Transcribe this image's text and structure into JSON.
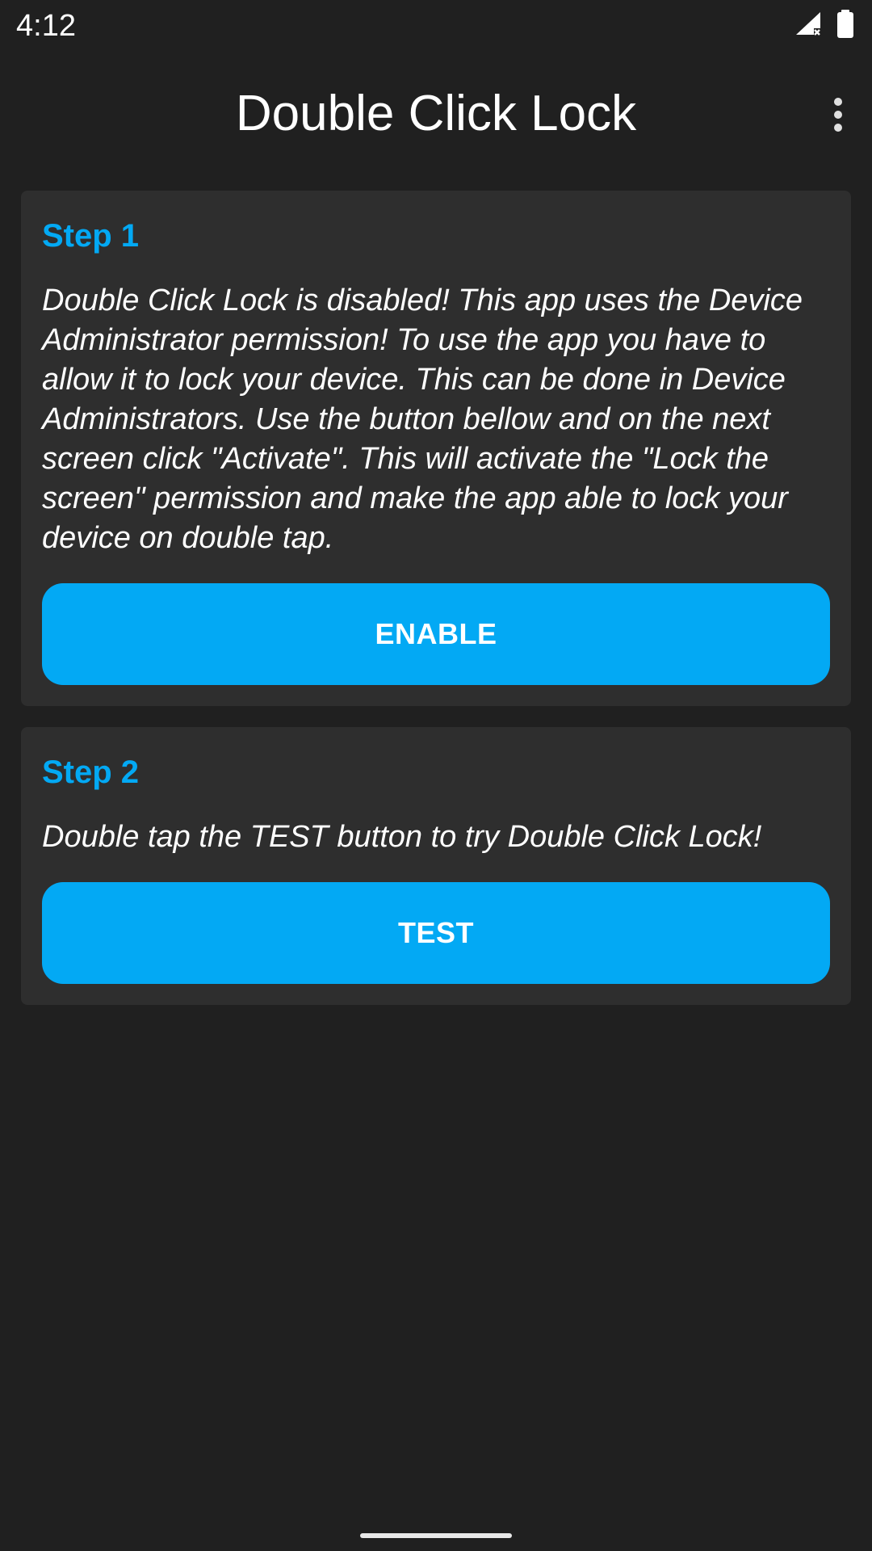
{
  "status_bar": {
    "time": "4:12",
    "icons": [
      "signal-no-data-icon",
      "battery-full-icon"
    ]
  },
  "app_bar": {
    "title": "Double Click Lock",
    "menu_icon": "overflow-menu-icon"
  },
  "cards": [
    {
      "heading": "Step 1",
      "body": "Double Click Lock is disabled! This app uses the Device Administrator permission! To use the app you have to allow it to lock your device. This can be done in Device Administrators. Use the button bellow and on the next screen click \"Activate\". This will activate the \"Lock the screen\" permission and make the app able to lock your device on double tap.",
      "button_label": "ENABLE"
    },
    {
      "heading": "Step 2",
      "body": "Double tap the TEST button to try Double Click Lock!",
      "button_label": "TEST"
    }
  ],
  "colors": {
    "background": "#202020",
    "card": "#2e2e2e",
    "accent": "#03a9f4",
    "text": "#ffffff"
  }
}
